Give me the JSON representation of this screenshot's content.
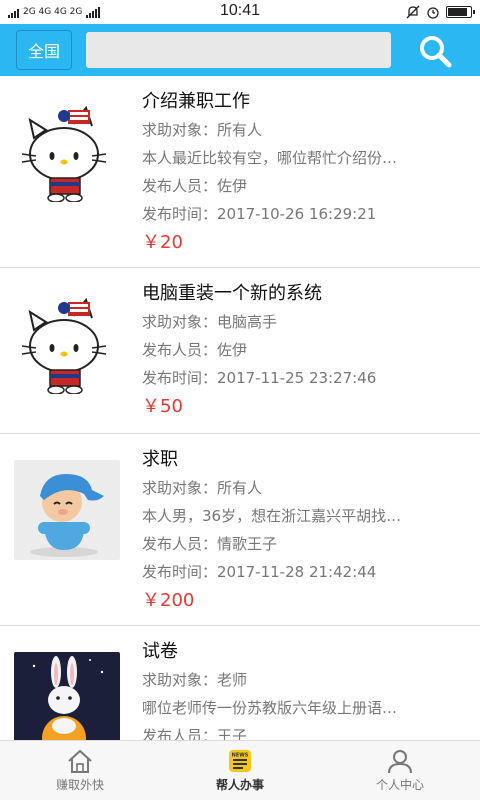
{
  "status": {
    "network": "2G 4G 4G 2G",
    "time": "10:41"
  },
  "header": {
    "region": "全国",
    "search_placeholder": ""
  },
  "items": [
    {
      "title": "介绍兼职工作",
      "target": "求助对象：所有人",
      "desc": "本人最近比较有空，哪位帮忙介绍份…",
      "poster": "发布人员：佐伊",
      "time": "发布时间：2017-10-26 16:29:21",
      "price": "￥20"
    },
    {
      "title": "电脑重装一个新的系统",
      "target": "求助对象：电脑高手",
      "poster": "发布人员：佐伊",
      "time": "发布时间：2017-11-25 23:27:46",
      "price": "￥50"
    },
    {
      "title": "求职",
      "target": "求助对象：所有人",
      "desc": "本人男，36岁，想在浙江嘉兴平胡找…",
      "poster": "发布人员：情歌王子",
      "time": "发布时间：2017-11-28 21:42:44",
      "price": "￥200"
    },
    {
      "title": "试卷",
      "target": "求助对象：老师",
      "desc": "哪位老师传一份苏教版六年级上册语…",
      "poster": "发布人员：王子"
    }
  ],
  "tabs": [
    {
      "label": "赚取外快",
      "badge": ""
    },
    {
      "label": "帮人办事",
      "badge": "NEWS"
    },
    {
      "label": "个人中心",
      "badge": ""
    }
  ],
  "colors": {
    "accent": "#2ab7f2",
    "price": "#e53935"
  }
}
